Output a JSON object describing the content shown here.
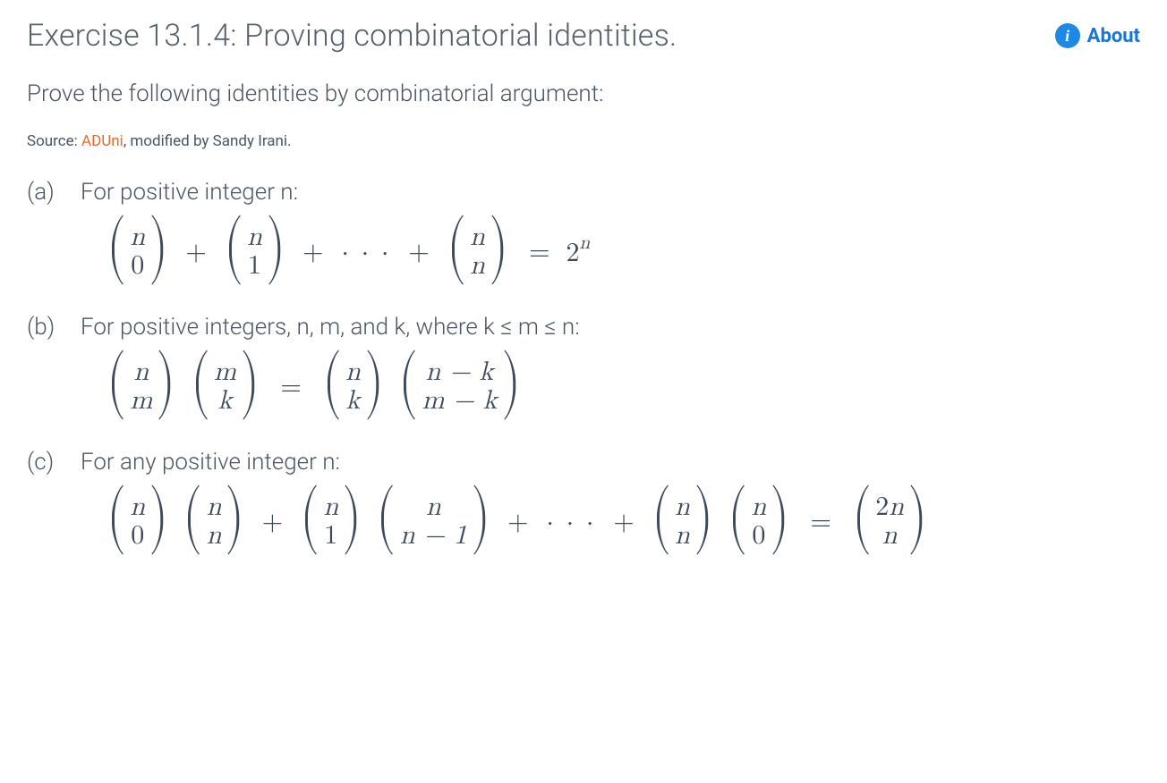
{
  "header": {
    "title": "Exercise 13.1.4: Proving combinatorial identities.",
    "about_label": "About"
  },
  "prompt": "Prove the following identities by combinatorial argument:",
  "source": {
    "prefix": "Source: ",
    "link_text": "ADUni",
    "suffix": ", modified by Sandy Irani."
  },
  "parts": {
    "a": {
      "label": "(a)",
      "lead": "For positive integer n:"
    },
    "b": {
      "label": "(b)",
      "lead": "For positive integers, n, m, and k, where k ≤ m ≤ n:"
    },
    "c": {
      "label": "(c)",
      "lead": "For any positive integer n:"
    }
  },
  "math": {
    "n": "n",
    "m": "m",
    "k": "k",
    "zero": "0",
    "one": "1",
    "two": "2",
    "two_n": "2n",
    "n_minus_k": "n − k",
    "m_minus_k": "m − k",
    "n_minus_1": "n − 1",
    "plus": "+",
    "equals": "=",
    "cdots": "· · ·"
  }
}
